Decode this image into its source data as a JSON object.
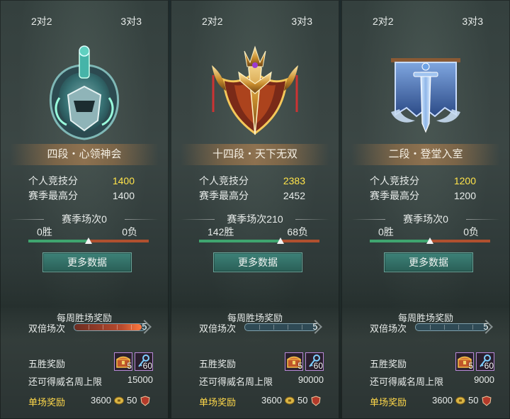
{
  "panels": [
    {
      "tab_2v2": "2对2",
      "tab_3v3": "3对3",
      "rank": "四段・心领神会",
      "emblem_icon": "teal-knight-helm-emblem-icon",
      "score_label": "个人竞技分",
      "score_value": "1400",
      "best_label": "赛季最高分",
      "best_value": "1400",
      "season_matches": "赛季场次0",
      "wins": "0胜",
      "losses": "0负",
      "win_fraction": 0.5,
      "more_button": "更多数据",
      "weekly_title": "每周胜场奖励",
      "double_label": "双倍场次",
      "double_value": "5",
      "double_fraction": 0.95,
      "five_win_label": "五胜奖励",
      "chest_qty": "5",
      "key_qty": "60",
      "cap_label": "还可得威名周上限",
      "cap_value": "15000",
      "match_reward_label": "单场奖励",
      "coins": "3600",
      "reputation": "50"
    },
    {
      "tab_2v2": "2对2",
      "tab_3v3": "3对3",
      "rank": "十四段・天下无双",
      "emblem_icon": "golden-winged-crest-emblem-icon",
      "score_label": "个人竞技分",
      "score_value": "2383",
      "best_label": "赛季最高分",
      "best_value": "2452",
      "season_matches": "赛季场次210",
      "wins": "142胜",
      "losses": "68负",
      "win_fraction": 0.676,
      "more_button": "更多数据",
      "weekly_title": "每周胜场奖励",
      "double_label": "双倍场次",
      "double_value": "5",
      "double_fraction": 0,
      "five_win_label": "五胜奖励",
      "chest_qty": "5",
      "key_qty": "60",
      "cap_label": "还可得威名周上限",
      "cap_value": "90000",
      "match_reward_label": "单场奖励",
      "coins": "3600",
      "reputation": "50"
    },
    {
      "tab_2v2": "2对2",
      "tab_3v3": "3对3",
      "rank": "二段・登堂入室",
      "emblem_icon": "blue-banner-sword-emblem-icon",
      "score_label": "个人竞技分",
      "score_value": "1200",
      "best_label": "赛季最高分",
      "best_value": "1200",
      "season_matches": "赛季场次0",
      "wins": "0胜",
      "losses": "0负",
      "win_fraction": 0.5,
      "more_button": "更多数据",
      "weekly_title": "每周胜场奖励",
      "double_label": "双倍场次",
      "double_value": "5",
      "double_fraction": 0,
      "five_win_label": "五胜奖励",
      "chest_qty": "5",
      "key_qty": "60",
      "cap_label": "还可得威名周上限",
      "cap_value": "9000",
      "match_reward_label": "单场奖励",
      "coins": "3600",
      "reputation": "50"
    }
  ],
  "colors": {
    "highlight_score": "#ffe34a",
    "reward_label": "#ffd84a",
    "win_bar": "#3fa56f",
    "loss_bar": "#b0502f",
    "button": "#2f6b62"
  }
}
